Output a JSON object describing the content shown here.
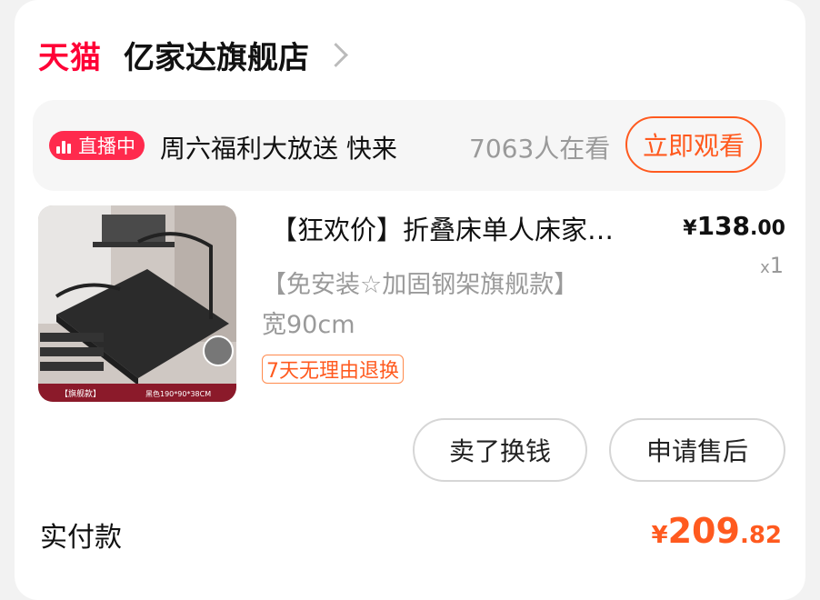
{
  "shop": {
    "platform_logo": "天猫",
    "name": "亿家达旗舰店"
  },
  "live": {
    "badge": "直播中",
    "title": "周六福利大放送 快来",
    "viewers": "7063人在看",
    "watch_label": "立即观看"
  },
  "product": {
    "title": "【狂欢价】折叠床单人床家…",
    "price_currency": "¥",
    "price_int": "138",
    "price_dec": ".00",
    "qty_prefix": "x",
    "qty": "1",
    "spec_line1": "【免安装☆加固钢架旗舰款】",
    "spec_line2": "宽90cm",
    "return_tag": "7天无理由退换",
    "thumb_label_left": "【旗舰款】",
    "thumb_label_right": "黑色190*90*38CM"
  },
  "actions": {
    "sell_label": "卖了换钱",
    "after_sale_label": "申请售后"
  },
  "payment": {
    "label": "实付款",
    "currency": "¥",
    "int": "209",
    "dec": ".82"
  },
  "colors": {
    "accent": "#ff5a1f",
    "tmall_red": "#ff0036",
    "live_red": "#ff2a4d"
  }
}
